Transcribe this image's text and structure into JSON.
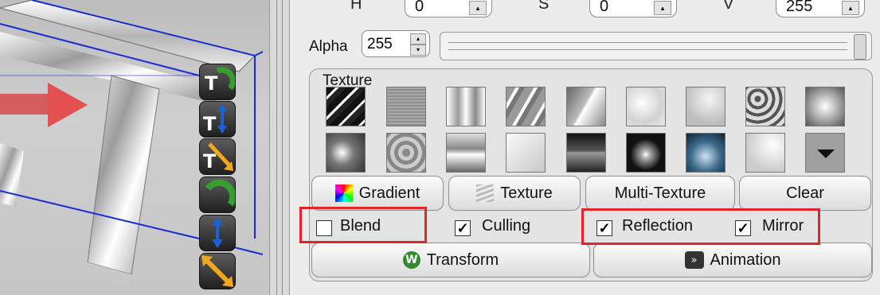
{
  "hsv": {
    "h_label": "H",
    "h_value": "0",
    "s_label": "S",
    "s_value": "0",
    "v_label": "V",
    "v_value": "255"
  },
  "alpha": {
    "label": "Alpha",
    "value": "255",
    "level": 1.0
  },
  "texture_group": {
    "title": "Texture"
  },
  "tabs": {
    "gradient": "Gradient",
    "texture": "Texture",
    "multi_texture": "Multi-Texture",
    "clear": "Clear"
  },
  "options": {
    "blend": "Blend",
    "blend_checked": false,
    "culling": "Culling",
    "culling_checked": true,
    "reflection": "Reflection",
    "reflection_checked": true,
    "mirror": "Mirror",
    "mirror_checked": true
  },
  "actions": {
    "transform": "Transform",
    "animation": "Animation"
  },
  "viewport_tools": [
    "rotate-text-icon",
    "move-text-icon",
    "scale-text-icon",
    "rotate-icon",
    "move-icon",
    "scale-icon"
  ],
  "colors": {
    "highlight": "#e0262b",
    "gizmo": "#1a2ad8",
    "arrow_red": "#e03a3a",
    "tool_orange": "#f2a81d",
    "tool_blue": "#1b5fd6",
    "tool_green": "#35a030"
  }
}
